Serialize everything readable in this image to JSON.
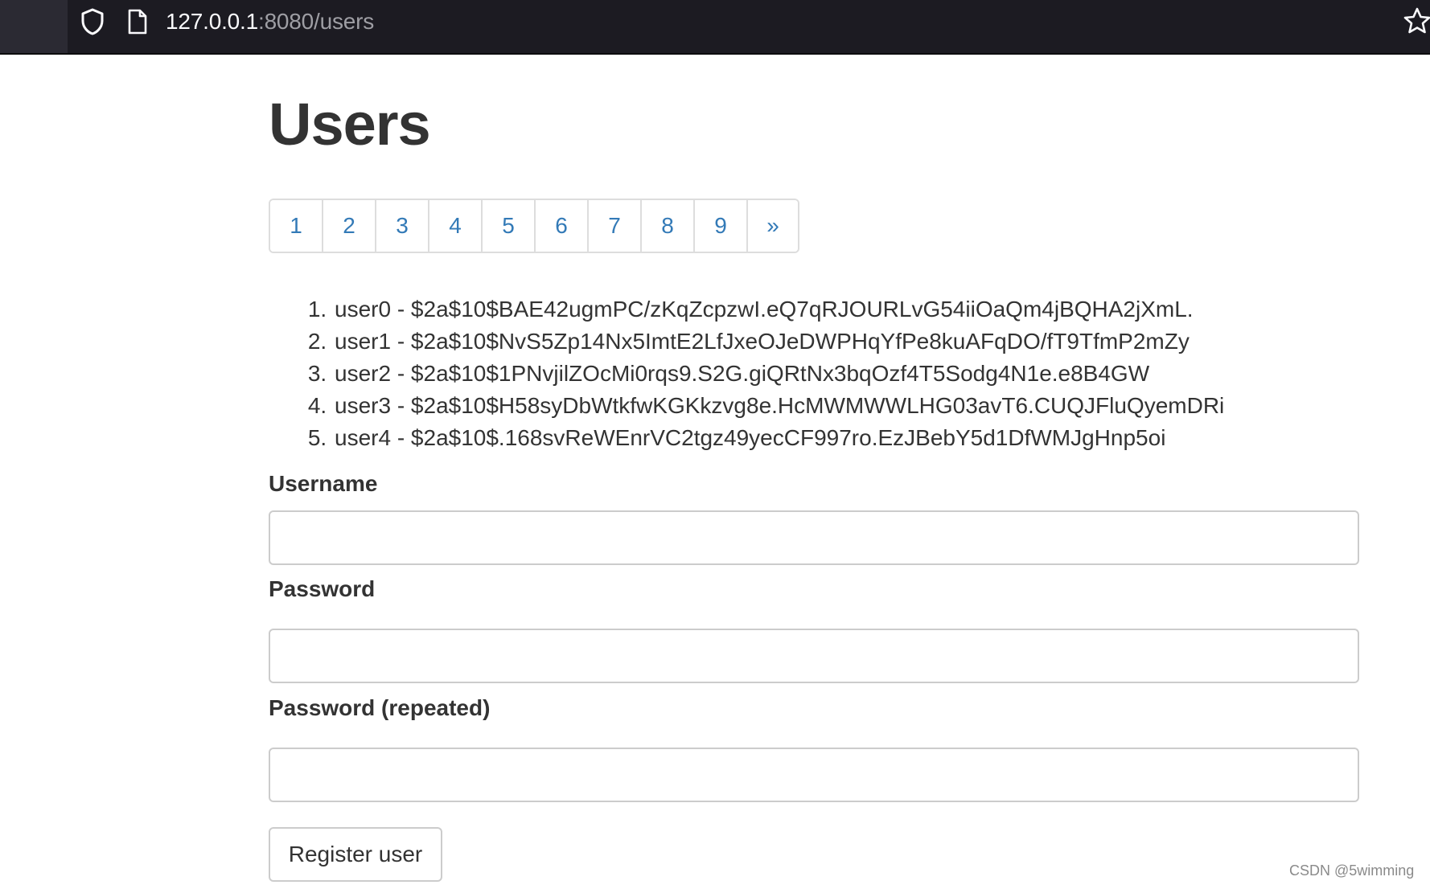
{
  "browser": {
    "url_host": "127.0.0.1",
    "url_rest": ":8080/users"
  },
  "page": {
    "title": "Users"
  },
  "pagination": [
    "1",
    "2",
    "3",
    "4",
    "5",
    "6",
    "7",
    "8",
    "9",
    "»"
  ],
  "users": [
    "user0 - $2a$10$BAE42ugmPC/zKqZcpzwI.eQ7qRJOURLvG54iiOaQm4jBQHA2jXmL.",
    "user1 - $2a$10$NvS5Zp14Nx5ImtE2LfJxeOJeDWPHqYfPe8kuAFqDO/fT9TfmP2mZy",
    "user2 - $2a$10$1PNvjilZOcMi0rqs9.S2G.giQRtNx3bqOzf4T5Sodg4N1e.e8B4GW",
    "user3 - $2a$10$H58syDbWtkfwKGKkzvg8e.HcMWMWWLHG03avT6.CUQJFluQyemDRi",
    "user4 - $2a$10$.168svReWEnrVC2tgz49yecCF997ro.EzJBebY5d1DfWMJgHnp5oi"
  ],
  "form": {
    "username_label": "Username",
    "username_value": "",
    "password_label": "Password",
    "password_value": "",
    "password_repeated_label": "Password (repeated)",
    "password_repeated_value": "",
    "submit_label": "Register user"
  },
  "watermark": "CSDN @5wimming"
}
